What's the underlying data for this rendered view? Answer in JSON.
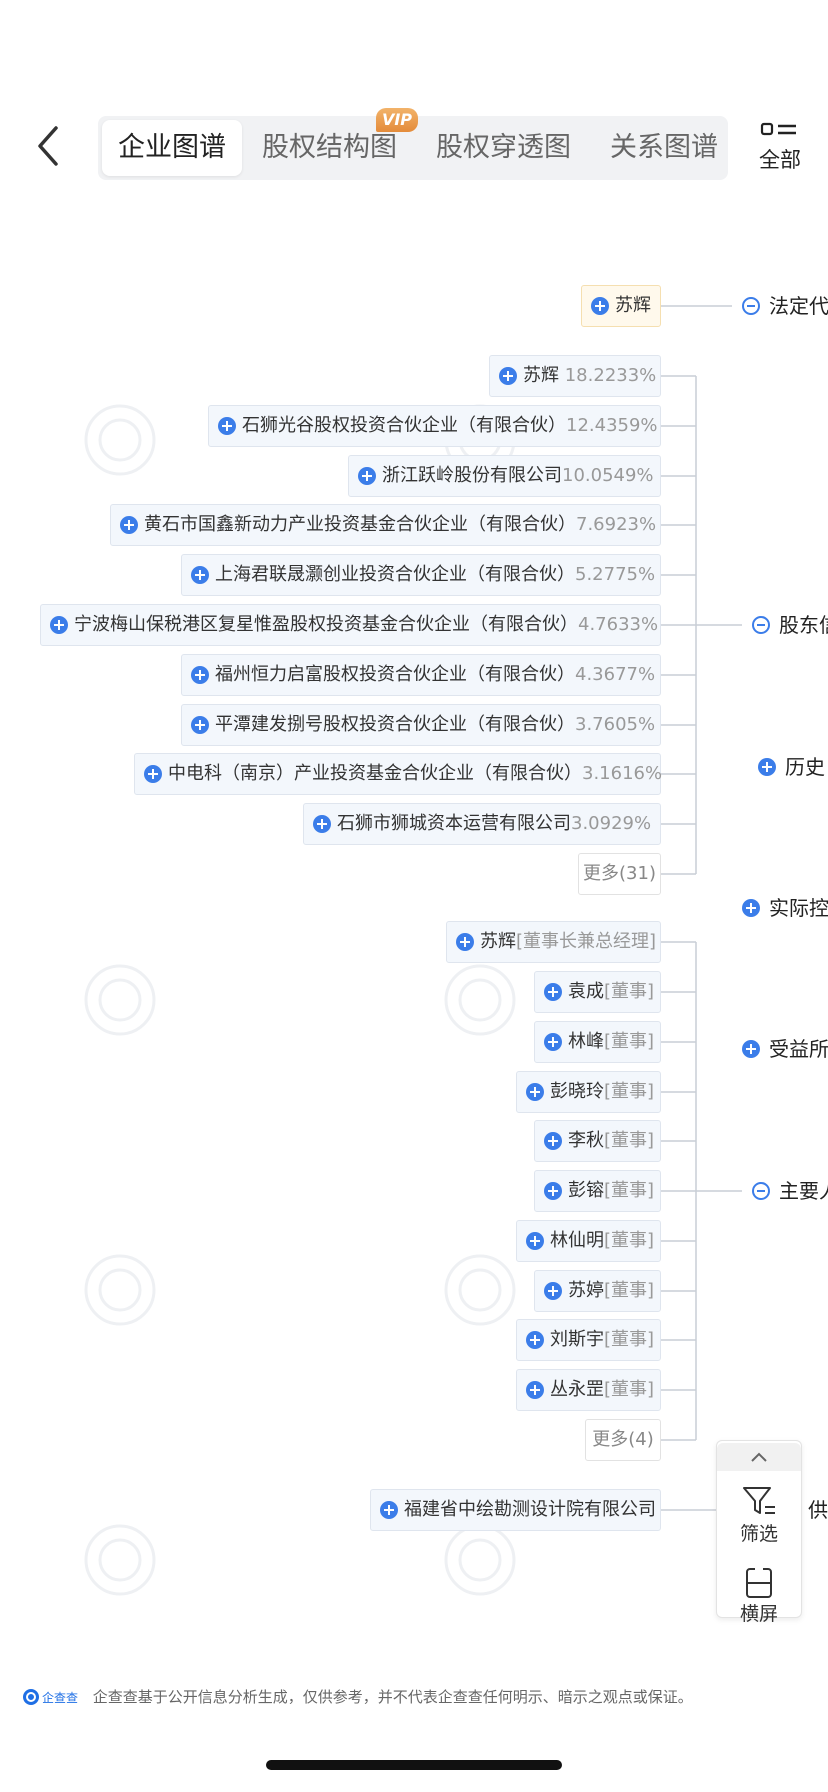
{
  "tabs": [
    {
      "label": "企业图谱",
      "active": true
    },
    {
      "label": "股权结构图",
      "badge": "VIP"
    },
    {
      "label": "股权穿透图"
    },
    {
      "label": "关系图谱"
    }
  ],
  "all_button": {
    "label": "全部"
  },
  "legal_rep": {
    "category": "法定代",
    "node": {
      "name": "苏辉"
    }
  },
  "shareholders": {
    "category": "股东信",
    "items": [
      {
        "name": "苏辉",
        "pct": "18.2233%"
      },
      {
        "name": "石狮光谷股权投资合伙企业（有限合伙）",
        "pct": "12.4359%"
      },
      {
        "name": "浙江跃岭股份有限公司",
        "pct": "10.0549%"
      },
      {
        "name": "黄石市国鑫新动力产业投资基金合伙企业（有限合伙）",
        "pct": "7.6923%"
      },
      {
        "name": "上海君联晟灏创业投资合伙企业（有限合伙）",
        "pct": "5.2775%"
      },
      {
        "name": "宁波梅山保税港区复星惟盈股权投资基金合伙企业（有限合伙）",
        "pct": "4.7633%"
      },
      {
        "name": "福州恒力启富股权投资合伙企业（有限合伙）",
        "pct": "4.3677%"
      },
      {
        "name": "平潭建发捌号股权投资合伙企业（有限合伙）",
        "pct": "3.7605%"
      },
      {
        "name": "中电科（南京）产业投资基金合伙企业（有限合伙）",
        "pct": "3.1616%"
      },
      {
        "name": "石狮市狮城资本运营有限公司",
        "pct": "3.0929%"
      }
    ],
    "more": "更多(31)"
  },
  "history": {
    "category": "历史"
  },
  "actual_controller": {
    "category": "实际控"
  },
  "beneficiary": {
    "category": "受益所"
  },
  "key_personnel": {
    "category": "主要人",
    "items": [
      {
        "name": "苏辉",
        "role": "[董事长兼总经理]"
      },
      {
        "name": "袁成",
        "role": "[董事]"
      },
      {
        "name": "林峰",
        "role": "[董事]"
      },
      {
        "name": "彭晓玲",
        "role": "[董事]"
      },
      {
        "name": "李秋",
        "role": "[董事]"
      },
      {
        "name": "彭镕",
        "role": "[董事]"
      },
      {
        "name": "林仙明",
        "role": "[董事]"
      },
      {
        "name": "苏婷",
        "role": "[董事]"
      },
      {
        "name": "刘斯宇",
        "role": "[董事]"
      },
      {
        "name": "丛永罡",
        "role": "[董事]"
      }
    ],
    "more": "更多(4)"
  },
  "supplier": {
    "category": "供",
    "node": {
      "name": "福建省中绘勘测设计院有限公司"
    }
  },
  "panel": {
    "filter_label": "筛选",
    "landscape_label": "横屏"
  },
  "footer": {
    "logo_text": "企查查",
    "text": "企查查基于公开信息分析生成，仅供参考，并不代表企查查任何明示、暗示之观点或保证。"
  },
  "colors": {
    "accent": "#3b7de9",
    "node_bg": "#f3f7fc",
    "vip": "#e48b3a"
  }
}
